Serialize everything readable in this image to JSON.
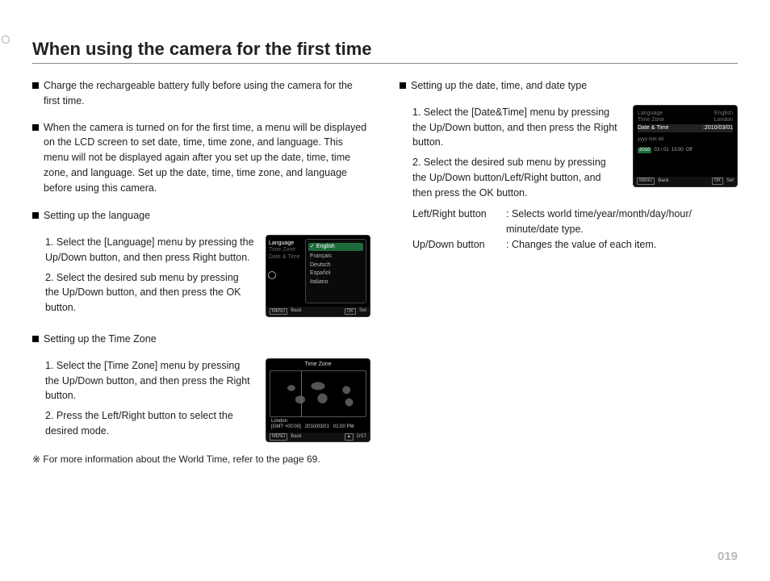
{
  "title": "When using the camera for the first time",
  "page_number": "019",
  "left": {
    "bullets": [
      "Charge the rechargeable battery fully before using the camera for the first time.",
      "When the camera is turned on for the first time, a menu will be displayed on the LCD screen to set date, time, time zone, and language. This menu will not be displayed again after you set up the date, time, time zone, and language. Set up the date, time, time zone, and language before using this camera."
    ],
    "lang_head": "Setting up the language",
    "lang_steps": [
      "Select the [Language] menu by pressing the Up/Down button, and then press Right button.",
      "Select the desired sub menu by pressing the Up/Down button, and then press the OK button."
    ],
    "tz_head": "Setting up the Time Zone",
    "tz_steps": [
      "Select the [Time Zone] menu by pressing the Up/Down button, and then press the Right button.",
      "Press the Left/Right button to select the desired mode."
    ],
    "note": "※ For more information about the World Time, refer to the page 69."
  },
  "right": {
    "head": "Setting up the date, time, and date type",
    "steps": [
      "Select the [Date&Time] menu by pressing the Up/Down button, and then press the Right button.",
      "Select the desired sub menu by pressing the Up/Down button/Left/Right button, and then press the OK button."
    ],
    "btn_lr_label": "Left/Right button",
    "btn_lr_text": ": Selects world time/year/month/day/hour/ minute/date type.",
    "btn_ud_label": "Up/Down button",
    "btn_ud_text": ": Changes the value of each item."
  },
  "lcd_lang": {
    "menu": {
      "language": "Language",
      "timezone": "Time Zone",
      "datetime": "Date & Time"
    },
    "options": [
      "English",
      "Français",
      "Deutsch",
      "Español",
      "Italiano"
    ],
    "foot_back_tag": "MENU",
    "foot_back": "Back",
    "foot_set_tag": "OK",
    "foot_set": "Set"
  },
  "lcd_tz": {
    "title": "Time Zone",
    "city": "London",
    "gmt": "[GMT +00:00]",
    "date": "2010/03/01",
    "time": "01:00 PM",
    "foot_back_tag": "MENU",
    "foot_back": "Back",
    "foot_dst_tag": "▲",
    "foot_dst": "DST"
  },
  "lcd_dt": {
    "menu": {
      "language": "Language",
      "lang_val": "English",
      "timezone": "Time Zone",
      "tz_val": "London",
      "datetime": "Date & Time",
      "dt_val": ":2010/03/01"
    },
    "fmt": "yyyy mm dd",
    "year": "2010",
    "md": "03 / 01",
    "hm": "13:00",
    "off": "Off",
    "foot_back_tag": "MENU",
    "foot_back": "Back",
    "foot_set_tag": "OK",
    "foot_set": "Set"
  }
}
